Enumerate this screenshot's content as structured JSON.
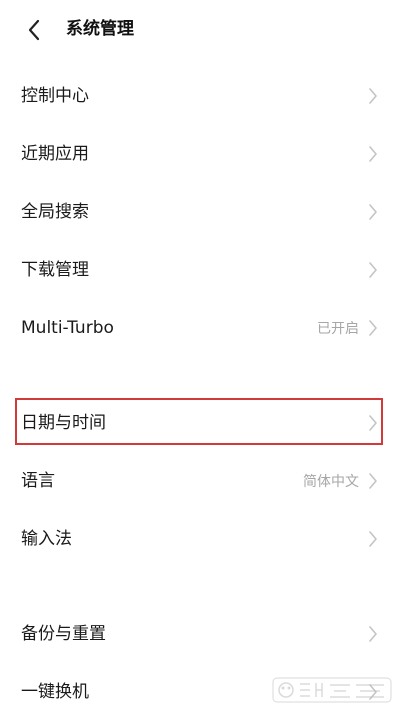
{
  "header": {
    "title": "系统管理"
  },
  "groups": [
    {
      "items": [
        {
          "label": "控制中心",
          "value": ""
        },
        {
          "label": "近期应用",
          "value": ""
        },
        {
          "label": "全局搜索",
          "value": ""
        },
        {
          "label": "下载管理",
          "value": ""
        },
        {
          "label": "Multi-Turbo",
          "value": "已开启"
        }
      ]
    },
    {
      "items": [
        {
          "label": "日期与时间",
          "value": ""
        },
        {
          "label": "语言",
          "value": "简体中文"
        },
        {
          "label": "输入法",
          "value": ""
        }
      ]
    },
    {
      "items": [
        {
          "label": "备份与重置",
          "value": ""
        },
        {
          "label": "一键换机",
          "value": ""
        }
      ]
    }
  ],
  "highlight_color": "#d23a3a",
  "icons": {
    "back": "chevron-left-icon",
    "row": "chevron-right-icon"
  }
}
